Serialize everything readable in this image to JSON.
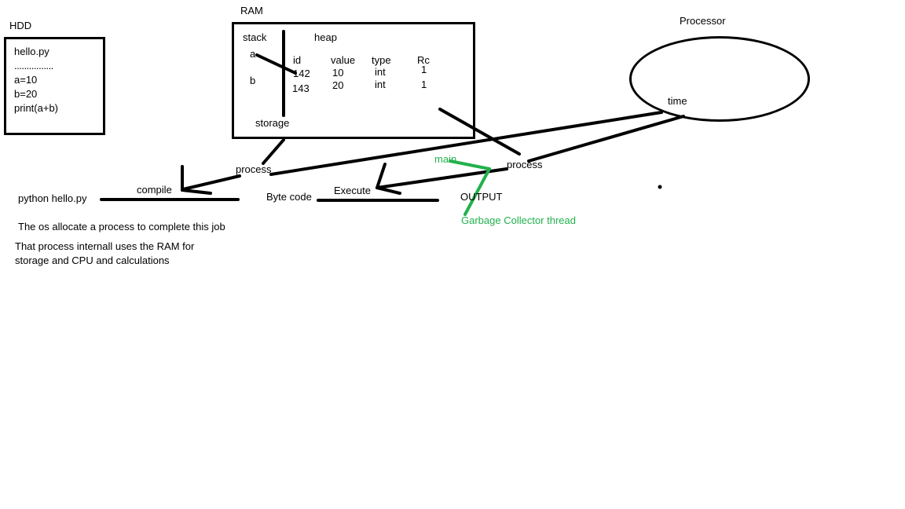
{
  "colors": {
    "ink": "#000000",
    "green": "#22b14c",
    "background": "#ffffff"
  },
  "hdd": {
    "title": "HDD",
    "file_name": "hello.py",
    "dots": "................",
    "line1": "a=10",
    "line2": "b=20",
    "line3": "print(a+b)"
  },
  "ram": {
    "title": "RAM",
    "stack": "stack",
    "heap": "heap",
    "var_a": "a",
    "var_b": "b",
    "storage": "storage",
    "table": {
      "headers": [
        "id",
        "value",
        "type",
        "Rc"
      ],
      "rows": [
        [
          "142",
          "10",
          "int",
          "1"
        ],
        [
          "143",
          "20",
          "int",
          "1"
        ]
      ]
    }
  },
  "processor": {
    "title": "Processor",
    "time": "time"
  },
  "flow": {
    "command": "python hello.py",
    "compile": "compile",
    "process_left": "process",
    "byte_code": "Byte code",
    "execute": "Execute",
    "process_right": "process",
    "main": "main",
    "output": "OUTPUT",
    "gc_thread": "Garbage Collector thread"
  },
  "notes": {
    "line1": "The os allocate a process to complete this job",
    "line2": "That process internall uses the RAM for",
    "line3": "storage and CPU and calculations"
  }
}
